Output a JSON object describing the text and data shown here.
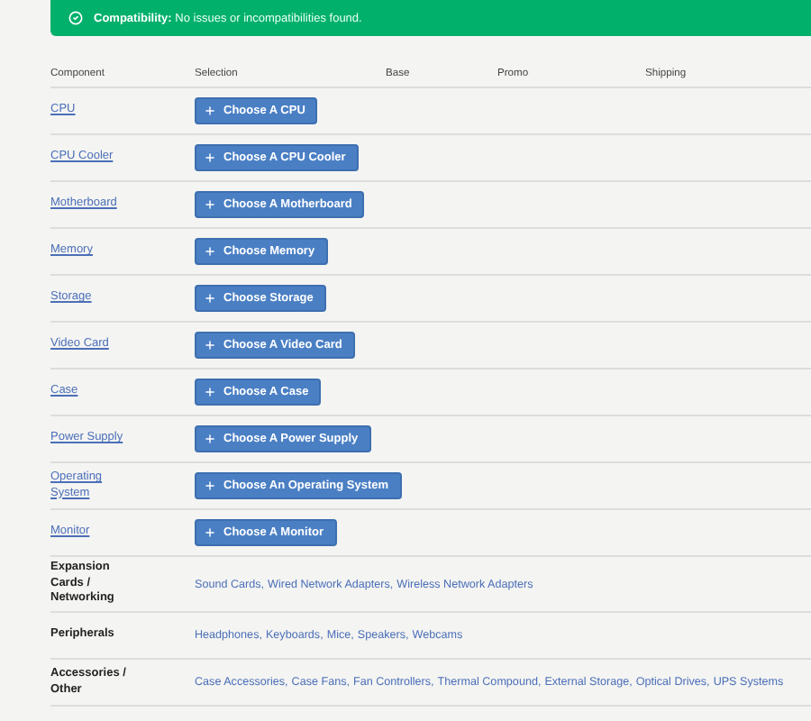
{
  "banner": {
    "message": "**Compatibility:** No issues or incompatibilities found."
  },
  "columns": [
    "Component",
    "Selection",
    "Base",
    "Promo",
    "Shipping"
  ],
  "rows": [
    {
      "kind": "product",
      "component": "CPU",
      "button": "Choose A CPU"
    },
    {
      "kind": "product",
      "component": "CPU Cooler",
      "button": "Choose A CPU Cooler"
    },
    {
      "kind": "product",
      "component": "Motherboard",
      "button": "Choose A Motherboard"
    },
    {
      "kind": "product",
      "component": "Memory",
      "button": "Choose Memory"
    },
    {
      "kind": "product",
      "component": "Storage",
      "button": "Choose Storage"
    },
    {
      "kind": "product",
      "component": "Video Card",
      "button": "Choose A Video Card"
    },
    {
      "kind": "product",
      "component": "Case",
      "button": "Choose A Case"
    },
    {
      "kind": "product",
      "component": "Power Supply",
      "button": "Choose A Power Supply"
    },
    {
      "kind": "product",
      "component": "Operating System",
      "button": "Choose An Operating System"
    },
    {
      "kind": "product",
      "component": "Monitor",
      "button": "Choose A Monitor"
    },
    {
      "kind": "category",
      "component": "Expansion Cards / Networking",
      "links": [
        "Sound Cards,",
        "Wired Network Adapters,",
        "Wireless Network Adapters"
      ]
    },
    {
      "kind": "category",
      "component": "Peripherals",
      "links": [
        "Headphones,",
        "Keyboards,",
        "Mice,",
        "Speakers,",
        "Webcams"
      ]
    },
    {
      "kind": "category",
      "component": "Accessories / Other",
      "links": [
        "Case Accessories,",
        "Case Fans,",
        "Fan Controllers,",
        "Thermal Compound,",
        "External Storage,",
        "Optical Drives,",
        "UPS Systems"
      ]
    }
  ]
}
